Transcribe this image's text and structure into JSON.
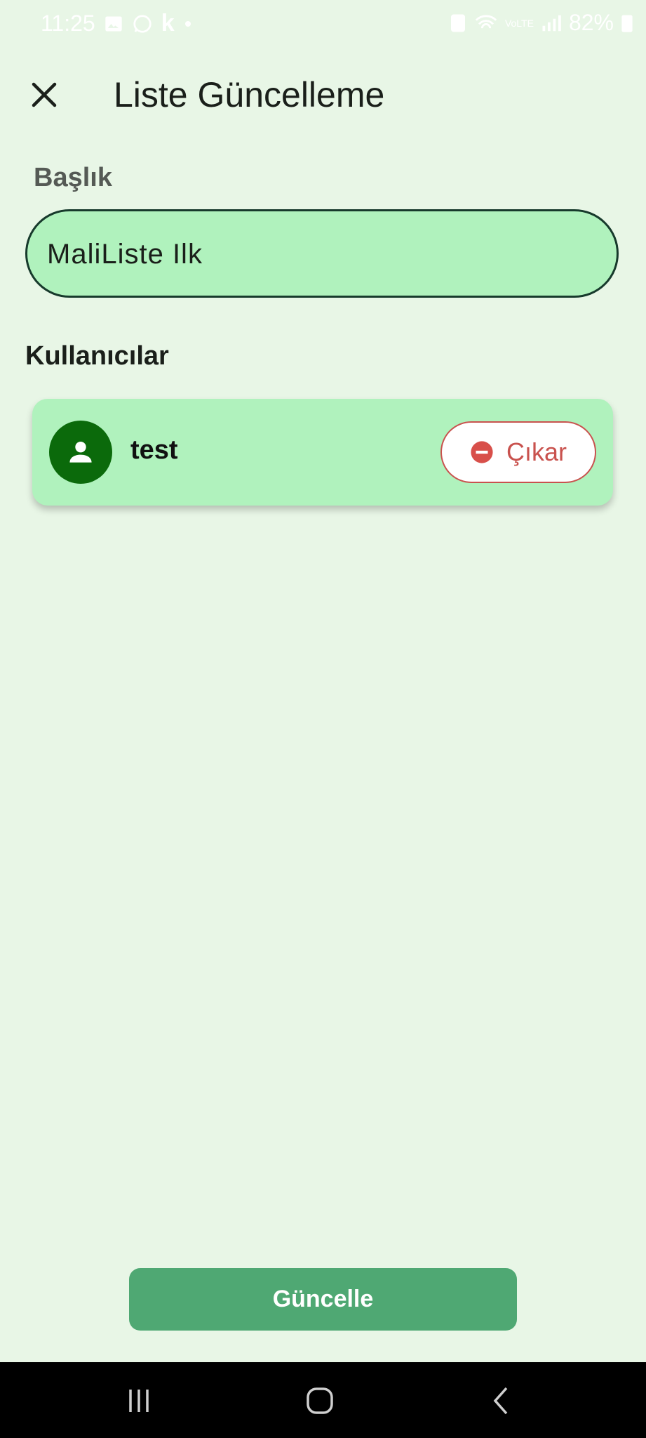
{
  "status_bar": {
    "time": "11:25",
    "battery": "82%",
    "network_label": "VoLTE"
  },
  "app_bar": {
    "title": "Liste Güncelleme"
  },
  "form": {
    "title_label": "Başlık",
    "title_value": "MaliListe Ilk",
    "users_section_title": "Kullanıcılar"
  },
  "users": [
    {
      "name": "test",
      "remove_label": "Çıkar"
    }
  ],
  "actions": {
    "update_label": "Güncelle"
  },
  "colors": {
    "background": "#e8f6e6",
    "card": "#b0f2bd",
    "avatar": "#0b6a0b",
    "danger": "#c9524e",
    "primary_button": "#4fa873"
  },
  "icons": {
    "close": "close-icon",
    "avatar": "person-icon",
    "remove": "remove-circle-icon",
    "nav_recent": "recent-apps-icon",
    "nav_home": "home-icon",
    "nav_back": "back-icon"
  }
}
